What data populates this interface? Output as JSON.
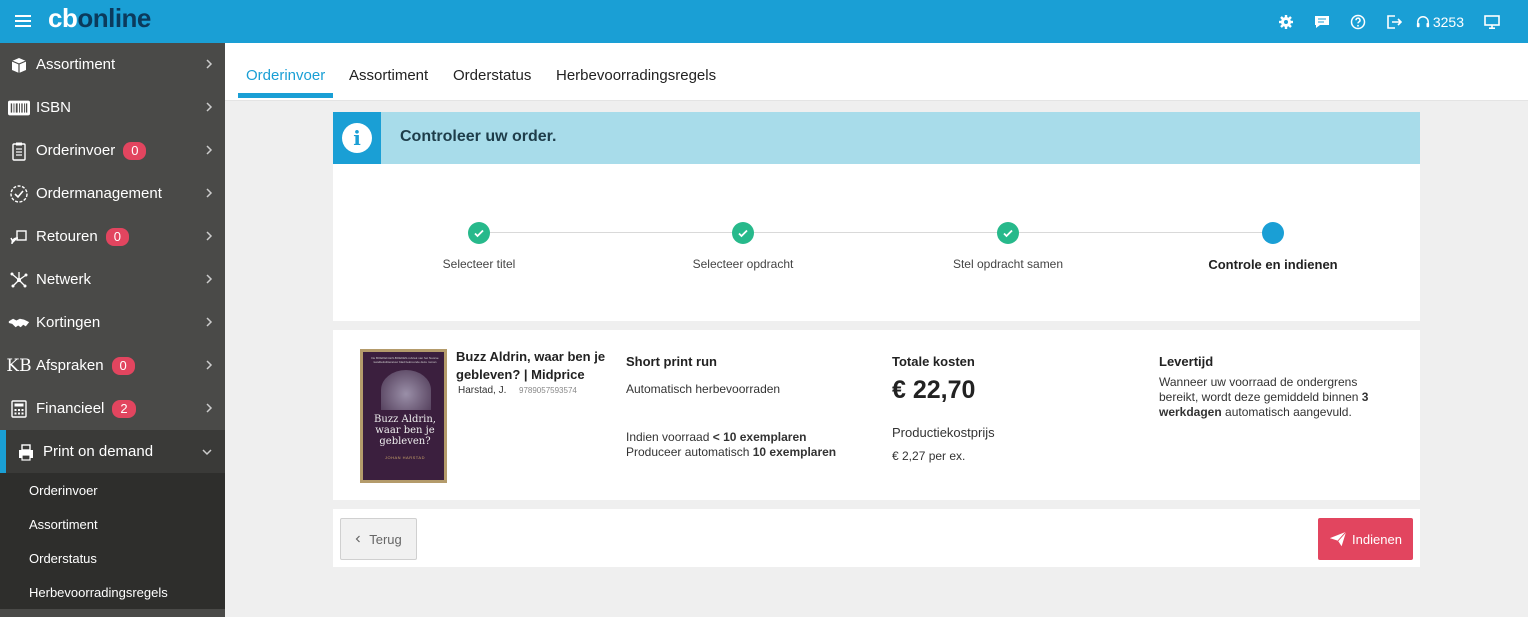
{
  "app": {
    "logo_cb": "cb",
    "logo_online": "online",
    "phone_number": "3253",
    "accent_color": "#1a9fd5",
    "badge_color": "#e2455f",
    "success_color": "#27b98b"
  },
  "topbar": {
    "icons": [
      "menu-icon",
      "settings-icon",
      "chat-icon",
      "help-icon",
      "logout-icon",
      "headset-icon",
      "monitor-icon"
    ]
  },
  "sidebar": {
    "items": [
      {
        "label": "Assortiment",
        "icon": "box-icon",
        "badge": null
      },
      {
        "label": "ISBN",
        "icon": "barcode-icon",
        "badge": null
      },
      {
        "label": "Orderinvoer",
        "icon": "clipboard-icon",
        "badge": "0"
      },
      {
        "label": "Ordermanagement",
        "icon": "check-circle-icon",
        "badge": null
      },
      {
        "label": "Retouren",
        "icon": "return-icon",
        "badge": "0"
      },
      {
        "label": "Netwerk",
        "icon": "network-icon",
        "badge": null
      },
      {
        "label": "Kortingen",
        "icon": "handshake-icon",
        "badge": null
      },
      {
        "label": "Afspraken",
        "icon": "kb-icon",
        "badge": "0"
      },
      {
        "label": "Financieel",
        "icon": "calculator-icon",
        "badge": "2"
      },
      {
        "label": "Print on demand",
        "icon": "printer-icon",
        "badge": null
      }
    ],
    "kb_text": "KB",
    "subitems": [
      "Orderinvoer",
      "Assortiment",
      "Orderstatus",
      "Herbevoorradingsregels"
    ]
  },
  "tabs": [
    "Orderinvoer",
    "Assortiment",
    "Orderstatus",
    "Herbevoorradingsregels"
  ],
  "banner": {
    "icon": "info-icon",
    "icon_glyph": "i",
    "text": "Controleer uw order."
  },
  "stepper": {
    "steps": [
      {
        "label": "Selecteer titel",
        "state": "done"
      },
      {
        "label": "Selecteer opdracht",
        "state": "done"
      },
      {
        "label": "Stel opdracht samen",
        "state": "done"
      },
      {
        "label": "Controle en indienen",
        "state": "current"
      }
    ]
  },
  "product": {
    "title": "Buzz Aldrin, waar ben je gebleven? | Midprice",
    "author": "Harstad, J.",
    "isbn": "9789057593574",
    "cover_title": "Buzz Aldrin, waar ben je gebleven?",
    "cover_author": "JOHAN HARSTAD",
    "cover_top": "De BOEKEN-EN-BOEKEN-rubriek van het Noorse kwaliteitslitteratuur blad bekroonde deze roman"
  },
  "print_run": {
    "heading": "Short print run",
    "subtitle": "Automatisch herbevoorraden",
    "rule_1_prefix": "Indien voorraad ",
    "rule_1_bold": "< 10 exemplaren",
    "rule_2_prefix": "Produceer automatisch ",
    "rule_2_bold": "10 exemplaren"
  },
  "costs": {
    "heading": "Totale kosten",
    "total": "€ 22,70",
    "unit_label": "Productiekostprijs",
    "unit_price": "€ 2,27 per ex."
  },
  "delivery": {
    "heading": "Levertijd",
    "text_prefix": "Wanneer uw voorraad de ondergrens bereikt, wordt deze gemiddeld binnen ",
    "text_bold": "3 werkdagen",
    "text_suffix": " automatisch aangevuld."
  },
  "actions": {
    "back_label": "Terug",
    "submit_label": "Indienen"
  }
}
